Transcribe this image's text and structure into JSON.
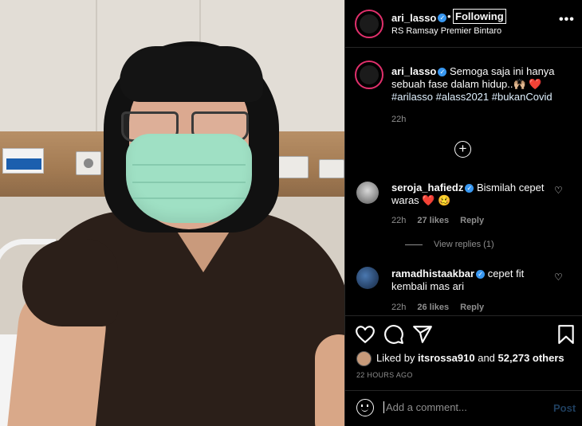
{
  "post": {
    "username": "ari_lasso",
    "follow_state": "Following",
    "location": "RS Ramsay Premier Bintaro",
    "more_label": "•••"
  },
  "caption": {
    "username": "ari_lasso",
    "text": "Semoga saja ini hanya sebuah fase dalam hidup..🙌🏼 ❤️",
    "hashtags": "#arilasso #alass2021 #bukanCovid",
    "time": "22h"
  },
  "comments": [
    {
      "username": "seroja_hafiedz",
      "text": "Bismilah cepet waras ❤️ 🥴",
      "time": "22h",
      "likes": "27 likes",
      "reply": "Reply",
      "view_replies": "View replies (1)"
    },
    {
      "username": "ramadhistaakbar",
      "text": "cepet fit kembali mas ari",
      "time": "22h",
      "likes": "26 likes",
      "reply": "Reply"
    }
  ],
  "likes": {
    "prefix": "Liked by ",
    "first_user": "itsrossa910",
    "middle": " and ",
    "others": "52,273 others"
  },
  "post_time": "22 HOURS AGO",
  "add_comment": {
    "placeholder": "Add a comment...",
    "post_label": "Post"
  },
  "colors": {
    "background": "#000000",
    "link_blue": "#e0f1ff",
    "verified": "#3897f0",
    "muted": "#8e8e8e",
    "post_button_disabled": "#1f3f5f"
  },
  "icons": [
    "heart-icon",
    "comment-icon",
    "share-icon",
    "bookmark-icon",
    "emoji-icon",
    "add-icon",
    "verified-icon",
    "more-icon"
  ]
}
